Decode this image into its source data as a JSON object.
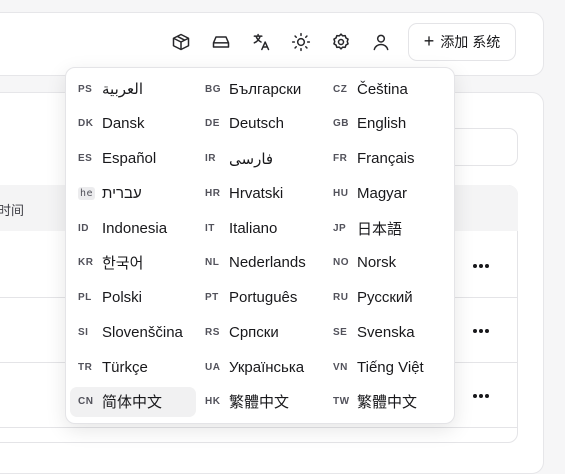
{
  "header": {
    "add_system_label": "添加 系统",
    "icons": [
      "box-icon",
      "drive-icon",
      "translate-icon",
      "sun-icon",
      "gear-icon",
      "user-icon"
    ]
  },
  "table": {
    "header_cell": "时间"
  },
  "languages": [
    {
      "code": "PS",
      "name": "العربية"
    },
    {
      "code": "BG",
      "name": "Български"
    },
    {
      "code": "CZ",
      "name": "Čeština"
    },
    {
      "code": "DK",
      "name": "Dansk"
    },
    {
      "code": "DE",
      "name": "Deutsch"
    },
    {
      "code": "GB",
      "name": "English"
    },
    {
      "code": "ES",
      "name": "Español"
    },
    {
      "code": "IR",
      "name": "فارسی"
    },
    {
      "code": "FR",
      "name": "Français"
    },
    {
      "code": "he",
      "name": "עברית"
    },
    {
      "code": "HR",
      "name": "Hrvatski"
    },
    {
      "code": "HU",
      "name": "Magyar"
    },
    {
      "code": "ID",
      "name": "Indonesia"
    },
    {
      "code": "IT",
      "name": "Italiano"
    },
    {
      "code": "JP",
      "name": "日本語"
    },
    {
      "code": "KR",
      "name": "한국어"
    },
    {
      "code": "NL",
      "name": "Nederlands"
    },
    {
      "code": "NO",
      "name": "Norsk"
    },
    {
      "code": "PL",
      "name": "Polski"
    },
    {
      "code": "PT",
      "name": "Português"
    },
    {
      "code": "RU",
      "name": "Русский"
    },
    {
      "code": "SI",
      "name": "Slovenščina"
    },
    {
      "code": "RS",
      "name": "Српски"
    },
    {
      "code": "SE",
      "name": "Svenska"
    },
    {
      "code": "TR",
      "name": "Türkçe"
    },
    {
      "code": "UA",
      "name": "Українська"
    },
    {
      "code": "VN",
      "name": "Tiếng Việt"
    },
    {
      "code": "CN",
      "name": "简体中文",
      "selected": true
    },
    {
      "code": "HK",
      "name": "繁體中文"
    },
    {
      "code": "TW",
      "name": "繁體中文"
    }
  ]
}
